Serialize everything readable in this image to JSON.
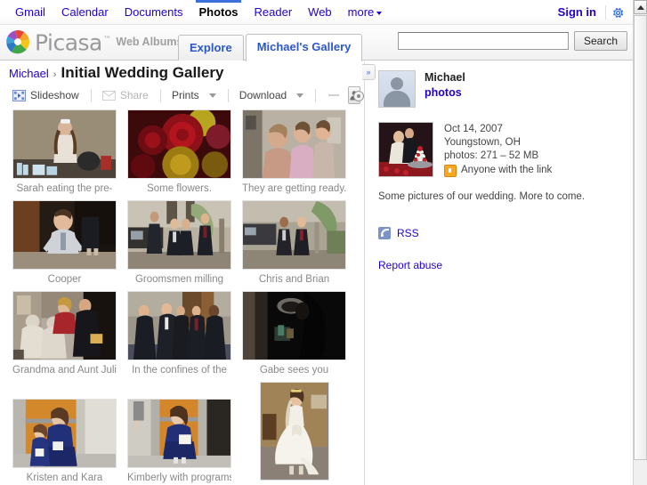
{
  "google_bar": {
    "links": [
      {
        "label": "Gmail",
        "current": false
      },
      {
        "label": "Calendar",
        "current": false
      },
      {
        "label": "Documents",
        "current": false
      },
      {
        "label": "Photos",
        "current": true
      },
      {
        "label": "Reader",
        "current": false
      },
      {
        "label": "Web",
        "current": false
      }
    ],
    "more_label": "more",
    "sign_in_label": "Sign in",
    "settings_icon": "gear-icon"
  },
  "brand": {
    "wordmark": "Picasa",
    "trademark": "™",
    "subtitle": "Web Albums",
    "logo_icon": "picasa-pinwheel-icon"
  },
  "tabs": [
    {
      "label": "Explore",
      "active": false
    },
    {
      "label": "Michael's Gallery",
      "active": true
    }
  ],
  "search": {
    "value": "",
    "placeholder": "",
    "button_label": "Search"
  },
  "breadcrumb": {
    "owner": "Michael",
    "separator": "›",
    "album_title": "Initial Wedding Gallery"
  },
  "toolbar": {
    "slideshow_label": "Slideshow",
    "share_label": "Share",
    "prints_label": "Prints",
    "download_label": "Download",
    "slideshow_icon": "slideshow-icon",
    "share_icon": "envelope-icon",
    "people_icon": "person-icon",
    "zoom_slider_value": "32"
  },
  "photos": [
    {
      "caption": "Sarah eating the pre-",
      "orientation": "landscape",
      "art": "sarah"
    },
    {
      "caption": "Some flowers.",
      "orientation": "landscape",
      "art": "flowers"
    },
    {
      "caption": "They are getting ready.",
      "orientation": "landscape",
      "art": "gettingready"
    },
    {
      "caption": "Cooper",
      "orientation": "landscape",
      "art": "cooper"
    },
    {
      "caption": "Groomsmen milling",
      "orientation": "landscape",
      "art": "groomsmen"
    },
    {
      "caption": "Chris and Brian",
      "orientation": "landscape",
      "art": "chrisbrian"
    },
    {
      "caption": "Grandma and Aunt Julie",
      "orientation": "landscape",
      "art": "grandma"
    },
    {
      "caption": "In the confines of the",
      "orientation": "landscape",
      "art": "confines"
    },
    {
      "caption": "Gabe sees you",
      "orientation": "landscape",
      "art": "gabe"
    },
    {
      "caption": "Kristen and Kara",
      "orientation": "landscape",
      "art": "kristen"
    },
    {
      "caption": "Kimberly with programs",
      "orientation": "landscape",
      "art": "kimberly"
    },
    {
      "caption": "",
      "orientation": "portrait",
      "art": "bride"
    }
  ],
  "sidebar": {
    "owner_name": "Michael",
    "owner_link": "photos",
    "avatar_icon": "user-avatar-icon",
    "album_date": "Oct 14, 2007",
    "album_location": "Youngstown, OH",
    "album_stats": "photos: 271 – 52 MB",
    "visibility": "Anyone with the link",
    "visibility_icon": "lock-icon",
    "description": "Some pictures of our wedding. More to come.",
    "rss_label": "RSS",
    "rss_icon": "rss-icon",
    "report_abuse_label": "Report abuse",
    "collapse_label": "»"
  },
  "colors": {
    "link_blue": "#2200cc",
    "tab_blue": "#2b57c6",
    "nav_accent": "#3b6fdc",
    "caption_gray": "#888888",
    "lock_orange": "#f7a722"
  }
}
